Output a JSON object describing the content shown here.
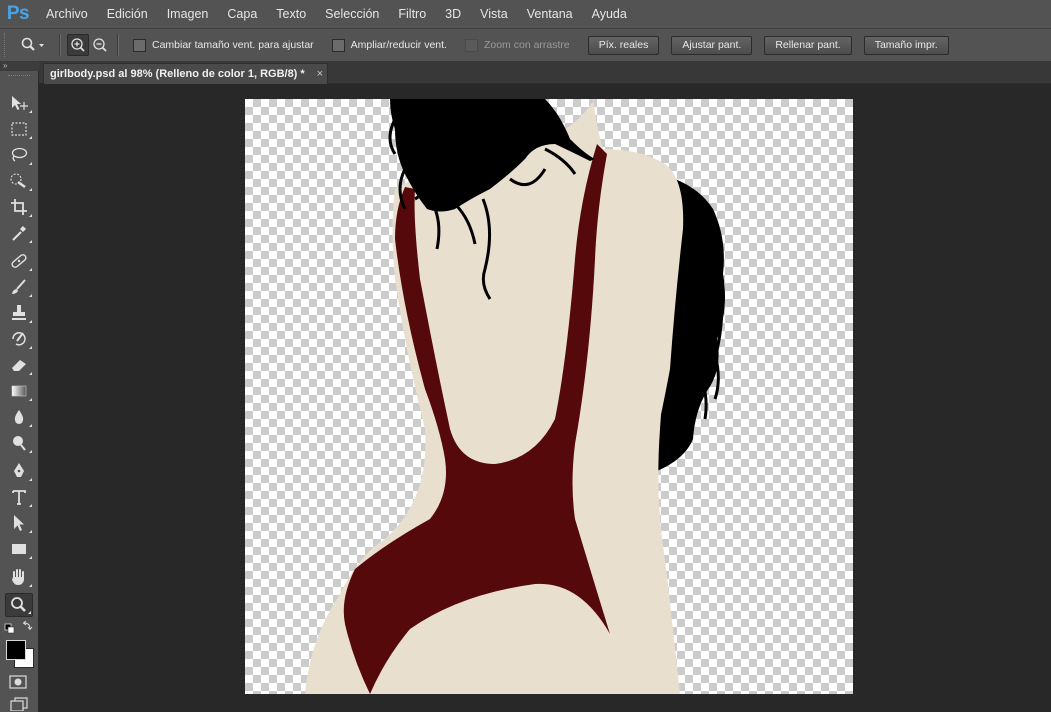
{
  "app": {
    "logo_text": "Ps"
  },
  "menu": [
    "Archivo",
    "Edición",
    "Imagen",
    "Capa",
    "Texto",
    "Selección",
    "Filtro",
    "3D",
    "Vista",
    "Ventana",
    "Ayuda"
  ],
  "options": {
    "resize_windows_label": "Cambiar tamaño vent. para ajustar",
    "zoom_all_windows_label": "Ampliar/reducir vent.",
    "scrubby_zoom_label": "Zoom con arrastre",
    "buttons": {
      "actual_pixels": "Píx. reales",
      "fit_screen": "Ajustar pant.",
      "fill_screen": "Rellenar pant.",
      "print_size": "Tamaño impr."
    }
  },
  "document": {
    "tab_title": "girlbody.psd al 98% (Relleno de color 1, RGB/8) *",
    "close_glyph": "×"
  },
  "tools_panel": {
    "collapse_glyph": "»"
  },
  "colors": {
    "foreground": "#000000",
    "background": "#ffffff",
    "skin": "#e9dfcf",
    "swimsuit": "#55090b",
    "hair": "#000000",
    "ui_panel": "#535353",
    "ui_workspace": "#282828",
    "ps_logo": "#4aa3e8"
  },
  "tools": [
    "move-tool",
    "marquee-tool",
    "lasso-tool",
    "quick-selection-tool",
    "crop-tool",
    "eyedropper-tool",
    "healing-brush-tool",
    "brush-tool",
    "clone-stamp-tool",
    "history-brush-tool",
    "eraser-tool",
    "gradient-tool",
    "blur-tool",
    "dodge-tool",
    "pen-tool",
    "type-tool",
    "path-selection-tool",
    "rectangle-tool",
    "hand-tool",
    "zoom-tool"
  ],
  "active_tool": "zoom-tool"
}
